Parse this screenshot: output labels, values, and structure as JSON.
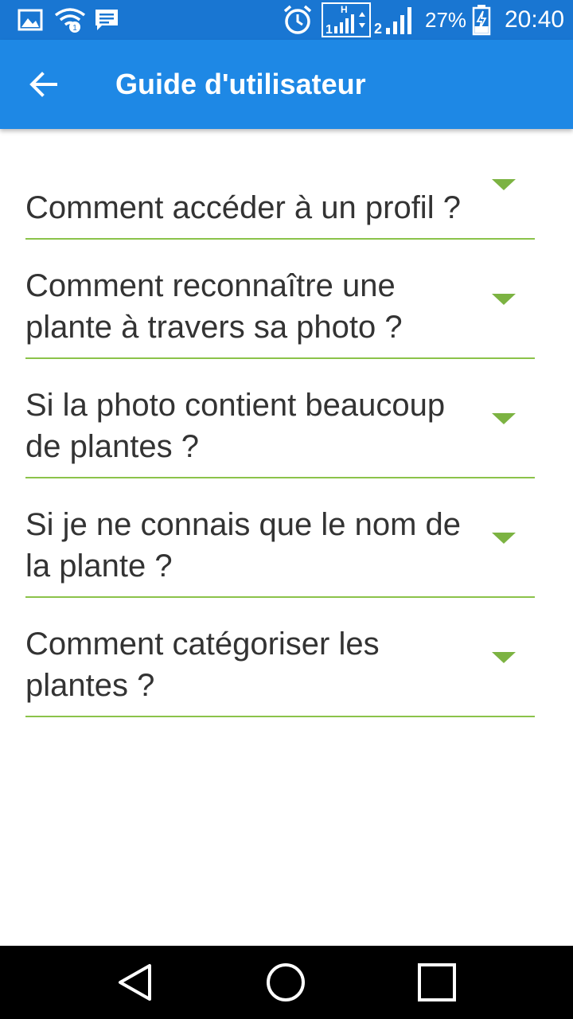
{
  "status_bar": {
    "icons": [
      "image-icon",
      "wifi-icon",
      "message-icon",
      "alarm-icon",
      "signal-sim1-icon",
      "signal-sim2-icon",
      "battery-icon"
    ],
    "sim1_label": "1",
    "sim1_network": "H",
    "sim2_label": "2",
    "battery": "27%",
    "time": "20:40"
  },
  "app_bar": {
    "title": "Guide d'utilisateur",
    "back_icon": "arrow-back-icon",
    "color": "#1e88e5"
  },
  "faq": {
    "divider_color": "#8bc34a",
    "arrow_color": "#7cb342",
    "items": [
      {
        "question": "Comment accéder à un profil ?"
      },
      {
        "question": "Comment reconnaître une plante à travers sa photo ?"
      },
      {
        "question": "Si la photo contient beaucoup de plantes ?"
      },
      {
        "question": "Si je ne connais que le nom de la plante ?"
      },
      {
        "question": "Comment catégoriser les plantes ?"
      }
    ]
  },
  "nav_bar": {
    "icons": [
      "back-triangle-icon",
      "home-circle-icon",
      "recents-square-icon"
    ]
  }
}
